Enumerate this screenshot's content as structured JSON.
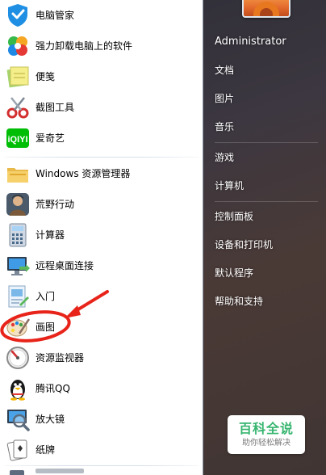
{
  "left_pane": {
    "pinned_items": [
      {
        "label": "电脑管家",
        "icon": "shield-icon"
      },
      {
        "label": "强力卸载电脑上的软件",
        "icon": "clover-icon"
      },
      {
        "label": "便笺",
        "icon": "sticky-note-icon"
      },
      {
        "label": "截图工具",
        "icon": "scissors-icon"
      },
      {
        "label": "爱奇艺",
        "icon": "iqiyi-icon"
      }
    ],
    "recent_items": [
      {
        "label": "Windows 资源管理器",
        "icon": "folder-icon"
      },
      {
        "label": "荒野行动",
        "icon": "game-character-icon"
      },
      {
        "label": "计算器",
        "icon": "calculator-icon"
      },
      {
        "label": "远程桌面连接",
        "icon": "remote-desktop-icon"
      },
      {
        "label": "入门",
        "icon": "getting-started-icon"
      },
      {
        "label": "画图",
        "icon": "paint-palette-icon"
      },
      {
        "label": "资源监视器",
        "icon": "gauge-icon"
      },
      {
        "label": "腾讯QQ",
        "icon": "qq-penguin-icon"
      },
      {
        "label": "放大镜",
        "icon": "magnifier-icon"
      },
      {
        "label": "纸牌",
        "icon": "cards-icon"
      }
    ]
  },
  "right_pane": {
    "user_name": "Administrator",
    "group1": [
      "文档",
      "图片",
      "音乐"
    ],
    "group2": [
      "游戏",
      "计算机"
    ],
    "group3": [
      "控制面板",
      "设备和打印机",
      "默认程序",
      "帮助和支持"
    ]
  },
  "annotation": {
    "highlighted_item": "画图",
    "color": "#e8241a"
  },
  "watermark": {
    "title": "百科全说",
    "subtitle": "助你轻松解决"
  }
}
